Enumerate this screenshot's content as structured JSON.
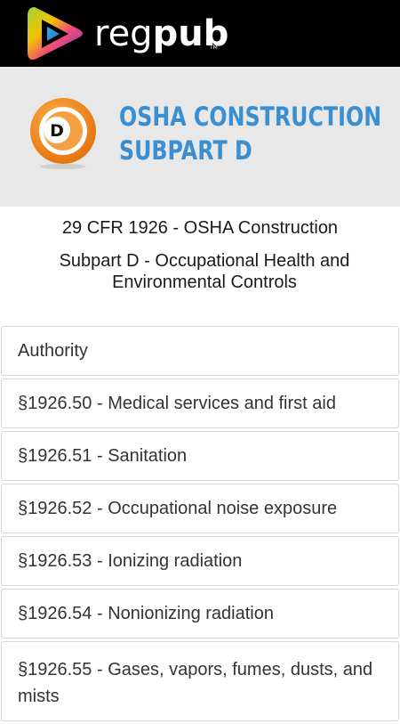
{
  "header": {
    "brand_light": "reg",
    "brand_bold": "pub",
    "brand_tm": "TM",
    "logo_icon": "play-triangle-icon",
    "colors": {
      "background": "#000000"
    }
  },
  "banner": {
    "badge_letter": "D",
    "title_line1": "OSHA CONSTRUCTION",
    "title_line2": "SUBPART D",
    "colors": {
      "title": "#3a8fd2",
      "badge": "#f28b1e",
      "background": "#e8e8e8"
    }
  },
  "intro": {
    "cfr": "29 CFR 1926 - OSHA Construction",
    "subpart": "Subpart D - Occupational Health and Environmental Controls"
  },
  "sections": [
    {
      "label": "Authority"
    },
    {
      "label": "§1926.50 - Medical services and first aid"
    },
    {
      "label": "§1926.51 - Sanitation"
    },
    {
      "label": "§1926.52 - Occupational noise exposure"
    },
    {
      "label": "§1926.53 - Ionizing radiation"
    },
    {
      "label": "§1926.54 - Nonionizing radiation"
    },
    {
      "label": "§1926.55 - Gases, vapors, fumes, dusts, and mists"
    }
  ]
}
